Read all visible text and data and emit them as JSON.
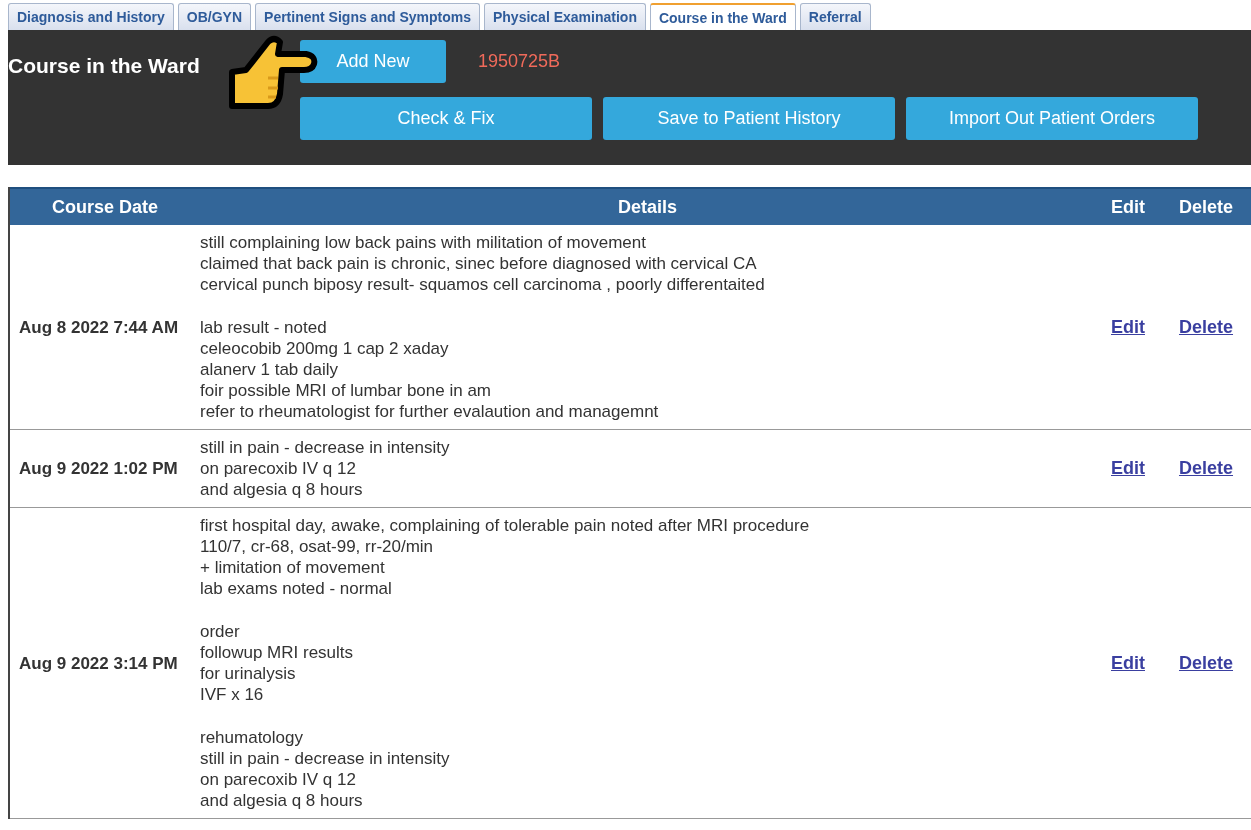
{
  "tabs": [
    {
      "label": "Diagnosis and History",
      "selected": false
    },
    {
      "label": "OB/GYN",
      "selected": false
    },
    {
      "label": "Pertinent Signs and Symptoms",
      "selected": false
    },
    {
      "label": "Physical Examination",
      "selected": false
    },
    {
      "label": "Course in the Ward",
      "selected": true
    },
    {
      "label": "Referral",
      "selected": false
    }
  ],
  "header": {
    "title": "Course in the Ward",
    "add_button": "Add New",
    "record_id": "1950725B",
    "buttons": [
      "Check & Fix",
      "Save to Patient History",
      "Import Out Patient Orders"
    ]
  },
  "table": {
    "columns": [
      "Course Date",
      "Details",
      "Edit",
      "Delete"
    ],
    "rows": [
      {
        "date": "Aug 8 2022 7:44 AM",
        "details": [
          "still complaining low back pains with militation of movement\nclaimed that back pain is chronic, sinec before diagnosed with cervical CA\ncervical punch biposy result- squamos cell carcinoma , poorly differentaited",
          "lab result - noted\nceleocobib 200mg 1 cap 2 xaday\nalanerv 1 tab daily\nfoir possible MRI of lumbar bone in am\nrefer to rheumatologist for further evalaution and managemnt"
        ],
        "edit": "Edit",
        "delete": "Delete"
      },
      {
        "date": "Aug 9 2022 1:02 PM",
        "details": [
          "still in pain - decrease in intensity\non parecoxib IV q 12\nand algesia q 8 hours"
        ],
        "edit": "Edit",
        "delete": "Delete"
      },
      {
        "date": "Aug 9 2022 3:14 PM",
        "details": [
          "first hospital day, awake, complaining of tolerable pain noted after MRI procedure\n110/7, cr-68, osat-99, rr-20/min\n+ limitation of movement\nlab exams noted - normal",
          "order\nfollowup MRI results\nfor urinalysis\nIVF x 16",
          "rehumatology\nstill in pain - decrease in intensity\non parecoxib IV q 12\nand algesia q 8 hours"
        ],
        "edit": "Edit",
        "delete": "Delete"
      }
    ]
  }
}
